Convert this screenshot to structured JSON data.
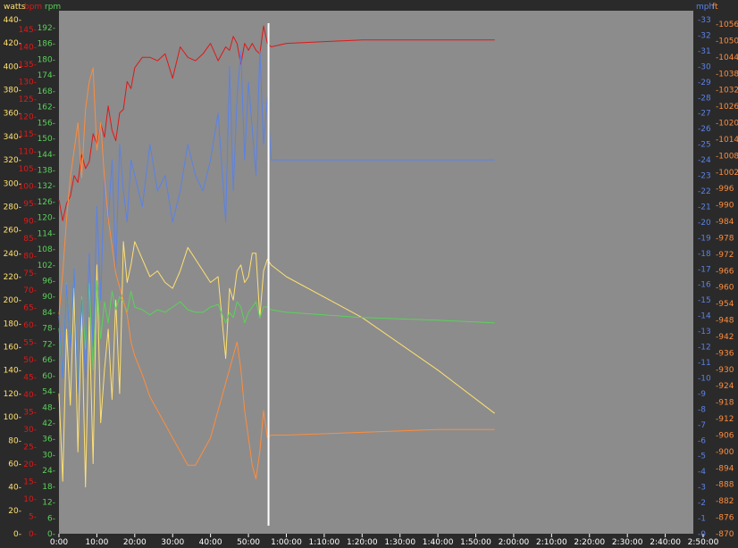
{
  "colors": {
    "background": "#2a2a2a",
    "plot": "#8c8c8c",
    "watts": "#ffe070",
    "bpm": "#e01818",
    "rpm": "#5ad25a",
    "mph": "#5a82e6",
    "ft": "#ff8c3c",
    "xaxis": "#ffffff",
    "cursor": "#ffffff"
  },
  "headers": {
    "watts": "watts",
    "bpm": "bpm",
    "rpm": "rpm",
    "mph": "mph",
    "ft": "ft"
  },
  "chart_data": {
    "type": "line",
    "grid": false,
    "x_unit": "minutes",
    "xlim": [
      0,
      170
    ],
    "x_ticks": [
      {
        "v": 0,
        "label": "0:00"
      },
      {
        "v": 10,
        "label": "10:00"
      },
      {
        "v": 20,
        "label": "20:00"
      },
      {
        "v": 30,
        "label": "30:00"
      },
      {
        "v": 40,
        "label": "40:00"
      },
      {
        "v": 50,
        "label": "50:00"
      },
      {
        "v": 60,
        "label": "1:00:00"
      },
      {
        "v": 70,
        "label": "1:10:00"
      },
      {
        "v": 80,
        "label": "1:20:00"
      },
      {
        "v": 90,
        "label": "1:30:00"
      },
      {
        "v": 100,
        "label": "1:40:00"
      },
      {
        "v": 110,
        "label": "1:50:00"
      },
      {
        "v": 120,
        "label": "2:00:00"
      },
      {
        "v": 130,
        "label": "2:10:00"
      },
      {
        "v": 140,
        "label": "2:20:00"
      },
      {
        "v": 150,
        "label": "2:30:00"
      },
      {
        "v": 160,
        "label": "2:40:00"
      },
      {
        "v": 170,
        "label": "2:50:00"
      }
    ],
    "cursor_x": 55.3,
    "axes": [
      {
        "id": "watts",
        "header": "watts",
        "side": "left",
        "ylim": [
          0,
          440
        ],
        "ticks": [
          "0",
          "20",
          "40",
          "60",
          "80",
          "100",
          "120",
          "140",
          "160",
          "180",
          "200",
          "220",
          "240",
          "260",
          "280",
          "300",
          "320",
          "340",
          "360",
          "380",
          "400",
          "420",
          "440"
        ]
      },
      {
        "id": "bpm",
        "header": "bpm",
        "side": "left",
        "ylim": [
          0,
          150
        ],
        "ticks": [
          "0",
          "5",
          "10",
          "15",
          "20",
          "25",
          "30",
          "35",
          "40",
          "45",
          "50",
          "55",
          "60",
          "65",
          "70",
          "75",
          "80",
          "85",
          "90",
          "95",
          "100",
          "105",
          "110",
          "115",
          "120",
          "125",
          "130",
          "135",
          "140",
          "145"
        ]
      },
      {
        "id": "rpm",
        "header": "rpm",
        "side": "left",
        "ylim": [
          0,
          195
        ],
        "ticks": [
          "0",
          "6",
          "12",
          "18",
          "24",
          "30",
          "36",
          "42",
          "48",
          "54",
          "60",
          "66",
          "72",
          "78",
          "84",
          "90",
          "96",
          "102",
          "108",
          "114",
          "120",
          "126",
          "132",
          "138",
          "144",
          "150",
          "156",
          "162",
          "168",
          "174",
          "180",
          "186",
          "192"
        ]
      },
      {
        "id": "mph",
        "header": "mph",
        "side": "right",
        "ylim": [
          0,
          33
        ],
        "ticks": [
          "0",
          "1",
          "2",
          "3",
          "4",
          "5",
          "6",
          "7",
          "8",
          "9",
          "10",
          "11",
          "12",
          "13",
          "14",
          "15",
          "16",
          "17",
          "18",
          "19",
          "20",
          "21",
          "22",
          "23",
          "24",
          "25",
          "26",
          "27",
          "28",
          "29",
          "30",
          "31",
          "32",
          "33"
        ]
      },
      {
        "id": "ft",
        "header": "ft",
        "side": "right",
        "ylim": [
          866,
          1059
        ],
        "ticks": [
          "870",
          "876",
          "882",
          "888",
          "894",
          "900",
          "906",
          "912",
          "918",
          "924",
          "930",
          "936",
          "942",
          "948",
          "954",
          "960",
          "966",
          "972",
          "978",
          "984",
          "990",
          "996",
          "1002",
          "1008",
          "1014",
          "1020",
          "1026",
          "1032",
          "1038",
          "1044",
          "1050",
          "1056"
        ]
      }
    ],
    "series": [
      {
        "axis": "bpm",
        "x": [
          0,
          1,
          2,
          3,
          4,
          5,
          6,
          7,
          8,
          9,
          10,
          11,
          12,
          13,
          14,
          15,
          16,
          17,
          18,
          19,
          20,
          22,
          24,
          26,
          28,
          30,
          32,
          34,
          36,
          38,
          40,
          42,
          44,
          45,
          46,
          47,
          48,
          49,
          50,
          51,
          52,
          53,
          54,
          55,
          56,
          60,
          80,
          100,
          115
        ],
        "y": [
          96,
          90,
          95,
          97,
          103,
          101,
          109,
          105,
          107,
          115,
          112,
          118,
          114,
          123,
          116,
          113,
          121,
          122,
          130,
          128,
          134,
          137,
          137,
          136,
          138,
          131,
          140,
          137,
          136,
          138,
          141,
          136,
          140,
          139,
          143,
          141,
          135,
          141,
          139,
          141,
          139,
          138,
          146,
          141,
          140,
          141,
          142,
          142,
          142
        ]
      },
      {
        "axis": "watts",
        "x": [
          0,
          1,
          2,
          3,
          4,
          5,
          6,
          7,
          8,
          9,
          10,
          11,
          12,
          13,
          14,
          15,
          16,
          17,
          18,
          19,
          20,
          22,
          24,
          26,
          28,
          30,
          32,
          34,
          36,
          38,
          40,
          42,
          44,
          45,
          46,
          47,
          48,
          49,
          50,
          51,
          52,
          53,
          54,
          55,
          56,
          60,
          80,
          100,
          115
        ],
        "y": [
          120,
          45,
          175,
          110,
          210,
          70,
          190,
          40,
          185,
          60,
          230,
          95,
          140,
          175,
          115,
          200,
          120,
          250,
          215,
          230,
          250,
          235,
          220,
          225,
          215,
          210,
          225,
          245,
          235,
          225,
          215,
          220,
          150,
          210,
          200,
          225,
          230,
          215,
          220,
          240,
          240,
          185,
          225,
          235,
          230,
          220,
          185,
          140,
          103
        ]
      },
      {
        "axis": "rpm",
        "x": [
          0,
          1,
          2,
          3,
          4,
          5,
          6,
          7,
          8,
          9,
          10,
          11,
          12,
          13,
          14,
          15,
          16,
          17,
          18,
          19,
          20,
          22,
          24,
          26,
          28,
          30,
          32,
          34,
          36,
          38,
          40,
          42,
          44,
          45,
          46,
          47,
          48,
          49,
          50,
          51,
          52,
          53,
          54,
          55,
          56,
          60,
          80,
          100,
          115
        ],
        "y": [
          78,
          60,
          95,
          72,
          100,
          55,
          90,
          70,
          95,
          62,
          96,
          74,
          88,
          80,
          92,
          85,
          90,
          88,
          84,
          92,
          86,
          85,
          83,
          85,
          84,
          86,
          88,
          85,
          84,
          84,
          86,
          87,
          80,
          84,
          82,
          88,
          86,
          80,
          84,
          86,
          88,
          82,
          86,
          86,
          85,
          84,
          82,
          81,
          80
        ]
      },
      {
        "axis": "mph",
        "x": [
          0,
          1,
          2,
          3,
          4,
          5,
          6,
          7,
          8,
          9,
          10,
          11,
          12,
          13,
          14,
          15,
          16,
          17,
          18,
          19,
          20,
          22,
          24,
          26,
          28,
          30,
          32,
          34,
          36,
          38,
          40,
          42,
          44,
          45,
          46,
          47,
          48,
          49,
          50,
          51,
          52,
          53,
          54,
          55,
          56,
          60,
          80,
          100,
          115
        ],
        "y": [
          14,
          10,
          16,
          12,
          17,
          9,
          15,
          10,
          18,
          12,
          21,
          15,
          23,
          20,
          24,
          17,
          25,
          22,
          20,
          24,
          23,
          21,
          25,
          22,
          23,
          20,
          22,
          25,
          23,
          22,
          24,
          27,
          20,
          30,
          22,
          28,
          31,
          24,
          29,
          26,
          23,
          31,
          25,
          28,
          24,
          24,
          24,
          24,
          24
        ]
      },
      {
        "axis": "ft",
        "x": [
          0,
          1,
          2,
          3,
          4,
          5,
          6,
          7,
          8,
          9,
          10,
          11,
          12,
          13,
          14,
          15,
          16,
          17,
          18,
          19,
          20,
          22,
          24,
          26,
          28,
          30,
          32,
          34,
          36,
          38,
          40,
          42,
          44,
          45,
          46,
          47,
          48,
          49,
          50,
          51,
          52,
          53,
          54,
          55,
          56,
          60,
          80,
          100,
          115
        ],
        "y": [
          950,
          965,
          985,
          1000,
          1010,
          1020,
          1000,
          1025,
          1035,
          1040,
          1010,
          1020,
          1000,
          985,
          975,
          965,
          960,
          955,
          950,
          940,
          935,
          928,
          920,
          915,
          910,
          905,
          900,
          895,
          895,
          900,
          905,
          915,
          925,
          930,
          935,
          940,
          930,
          915,
          905,
          895,
          890,
          900,
          915,
          905,
          906,
          906,
          907,
          908,
          908
        ]
      }
    ]
  }
}
